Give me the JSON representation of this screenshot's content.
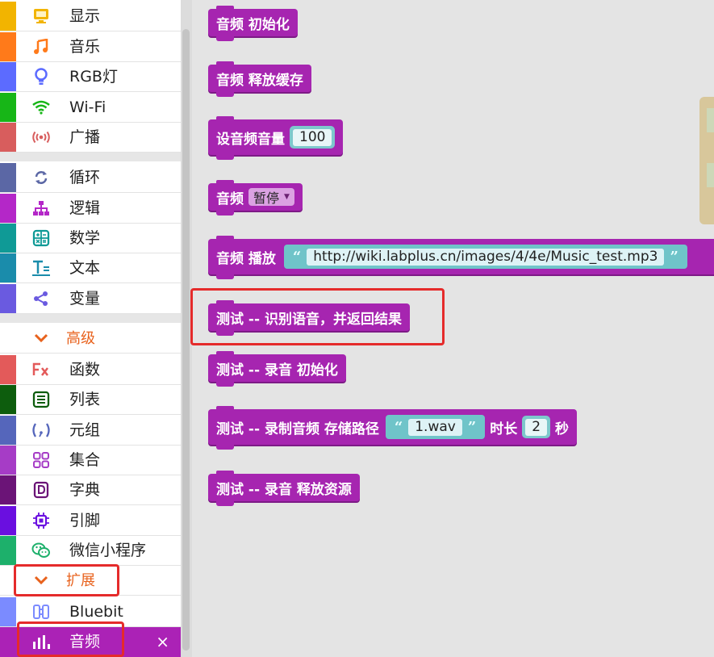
{
  "sidebar": {
    "categories": [
      {
        "label": "显示",
        "color": "#f2b400",
        "icon": "display-icon"
      },
      {
        "label": "音乐",
        "color": "#ff7a1a",
        "icon": "music-note-icon"
      },
      {
        "label": "RGB灯",
        "color": "#5c6bff",
        "icon": "lightbulb-icon"
      },
      {
        "label": "Wi-Fi",
        "color": "#17b617",
        "icon": "wifi-icon"
      },
      {
        "label": "广播",
        "color": "#d85d5d",
        "icon": "broadcast-icon"
      },
      {
        "label": "循环",
        "color": "#5b67a5",
        "icon": "loop-icon"
      },
      {
        "label": "逻辑",
        "color": "#b427c8",
        "icon": "logic-tree-icon"
      },
      {
        "label": "数学",
        "color": "#0f9a96",
        "icon": "calculator-icon"
      },
      {
        "label": "文本",
        "color": "#1a8cab",
        "icon": "text-icon"
      },
      {
        "label": "变量",
        "color": "#6a5ae0",
        "icon": "variable-icon"
      },
      {
        "label": "函数",
        "color": "#e35a5a",
        "icon": "function-icon"
      },
      {
        "label": "列表",
        "color": "#0d5d0d",
        "icon": "list-icon"
      },
      {
        "label": "元组",
        "color": "#5566bb",
        "icon": "tuple-icon"
      },
      {
        "label": "集合",
        "color": "#a63cc6",
        "icon": "set-icon"
      },
      {
        "label": "字典",
        "color": "#6b1477",
        "icon": "dictionary-icon"
      },
      {
        "label": "引脚",
        "color": "#6a0fe0",
        "icon": "chip-icon"
      },
      {
        "label": "微信小程序",
        "color": "#1db06b",
        "icon": "wechat-icon"
      },
      {
        "label": "Bluebit",
        "color": "#7b8bff",
        "icon": "bluebit-icon"
      }
    ],
    "advanced_label": "高级",
    "extensions_label": "扩展",
    "active": {
      "label": "音频",
      "color": "#ab22b6",
      "icon": "audio-bars-icon",
      "close": "×"
    }
  },
  "workspace": {
    "blocks": {
      "init": "音频 初始化",
      "release_cache": "音频 释放缓存",
      "set_volume": "设音频音量",
      "volume_value": "100",
      "audio_word": "音频",
      "pause_option": "暂停",
      "play": "音频 播放",
      "play_url": "http://wiki.labplus.cn/images/4/4e/Music_test.mp3",
      "recognize": "测试 -- 识别语音，并返回结果",
      "record_init": "测试 -- 录音 初始化",
      "record_audio": "测试 -- 录制音频 存储路径",
      "record_file": "1.wav",
      "duration_label": "时长",
      "duration_value": "2",
      "seconds_label": "秒",
      "record_release": "测试 -- 录音 释放资源"
    },
    "quote_open": "“",
    "quote_close": "”"
  },
  "colors": {
    "audio_block": "#a625b0",
    "highlight_box": "#e52b2b",
    "advanced_text": "#e8621d"
  }
}
